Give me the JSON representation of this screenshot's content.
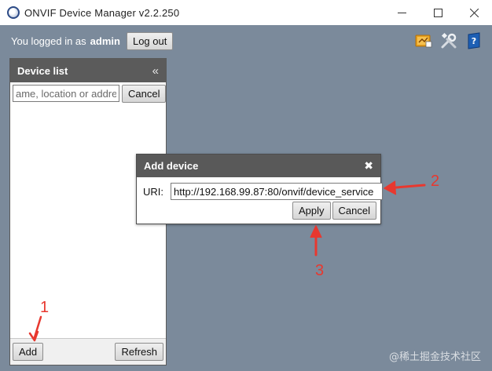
{
  "window": {
    "title": "ONVIF Device Manager v2.2.250",
    "minimize_icon": "minimize-icon",
    "maximize_icon": "maximize-icon",
    "close_icon": "close-icon"
  },
  "header": {
    "logged_in_text": "You logged in as",
    "username": "admin",
    "logout_label": "Log out",
    "icons": [
      "event-log-icon",
      "tools-icon",
      "help-icon"
    ]
  },
  "device_list": {
    "title": "Device list",
    "collapse_glyph": "«",
    "search": {
      "value": "",
      "placeholder": "ame, location or address"
    },
    "cancel_label": "Cancel",
    "add_label": "Add",
    "refresh_label": "Refresh"
  },
  "add_device": {
    "title": "Add device",
    "close_glyph": "✖",
    "uri_label": "URI:",
    "uri_value": "http://192.168.99.87:80/onvif/device_service",
    "apply_label": "Apply",
    "cancel_label": "Cancel"
  },
  "annotations": {
    "step1": "1",
    "step2": "2",
    "step3": "3",
    "color": "#e8382f"
  },
  "watermark": "@稀土掘金技术社区",
  "colors": {
    "background": "#7b8a9b",
    "panel_header": "#5b5b5b",
    "annotation": "#e8382f"
  }
}
